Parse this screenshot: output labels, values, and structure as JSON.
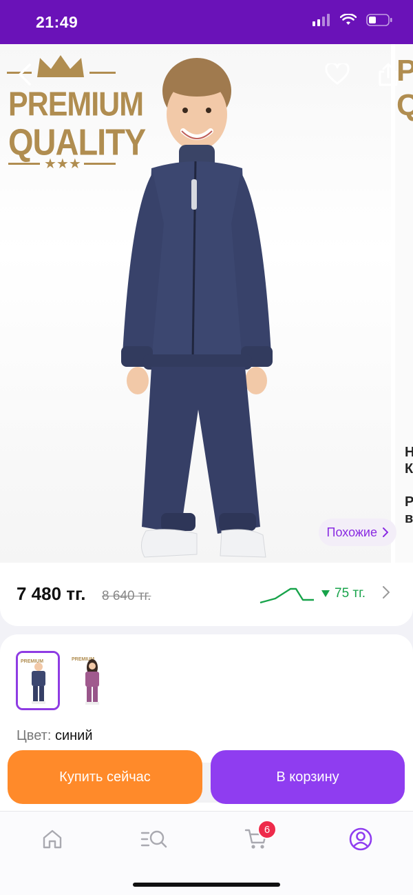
{
  "status_bar": {
    "time": "21:49"
  },
  "hero": {
    "badge_line1": "PREMIUM",
    "badge_line2": "QUALITY",
    "badge_stars": "★★★",
    "similar_label": "Похожие",
    "side_badge": "P\nQ",
    "side_text": "Н\nК\n\nР\nв"
  },
  "pricing": {
    "price": "7 480 тг.",
    "old_price": "8 640 тг.",
    "drop": "75 тг.",
    "trend_color": "#17a34a"
  },
  "variants": {
    "color_label": "Цвет:",
    "color_value": "синий"
  },
  "actions": {
    "buy_now": "Купить сейчас",
    "add_to_cart": "В корзину"
  },
  "tabbar": {
    "cart_count": "6",
    "active_color": "#8f3df0"
  },
  "colors": {
    "status_bar": "#6a12b8",
    "buy_button": "#ff8a2a",
    "cart_button": "#8f3df0",
    "badge_gold": "#b08d50"
  }
}
